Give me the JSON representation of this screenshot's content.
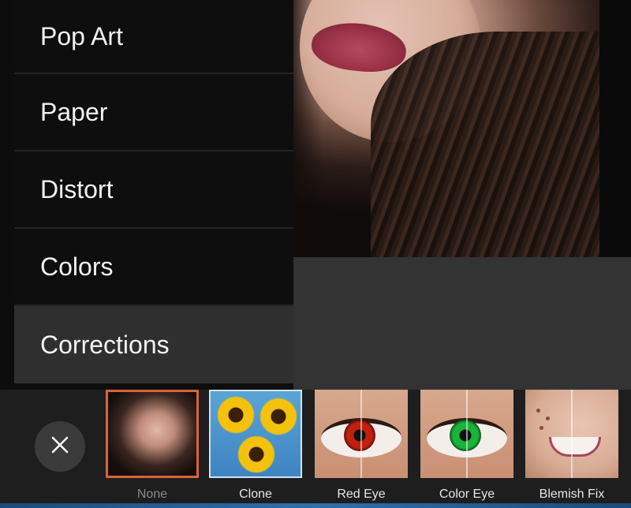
{
  "menu": {
    "items": [
      {
        "label": "Pop Art"
      },
      {
        "label": "Paper"
      },
      {
        "label": "Distort"
      },
      {
        "label": "Colors"
      },
      {
        "label": "Corrections"
      }
    ],
    "selected": "Corrections"
  },
  "effects": {
    "close_icon": "close-icon",
    "items": [
      {
        "label": "None",
        "selected": true
      },
      {
        "label": "Clone"
      },
      {
        "label": "Red Eye"
      },
      {
        "label": "Color Eye"
      },
      {
        "label": "Blemish Fix"
      }
    ]
  },
  "colors": {
    "accent": "#d9643a",
    "menu_bg": "#0e0e0e",
    "selected_bg": "#2f2f2f"
  }
}
